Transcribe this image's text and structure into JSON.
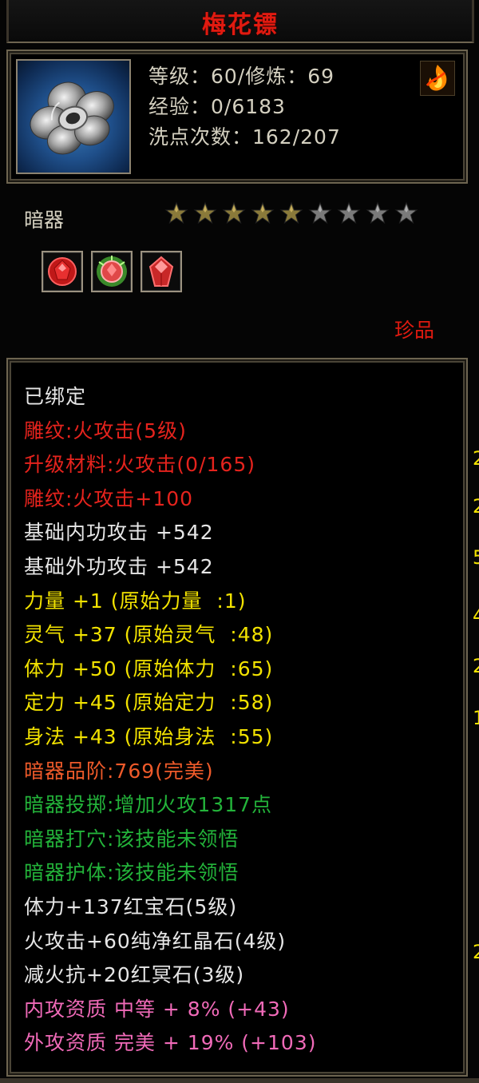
{
  "title": "梅花镖",
  "header": {
    "level_line": "等级：60/修炼：69",
    "exp_line": "经验：0/6183",
    "reset_line": "洗点次数：162/207",
    "icon": "plum-blossom-dart-icon",
    "badge_icon": "fire-element-icon"
  },
  "item_type": "暗器",
  "stars": {
    "filled": 5,
    "total": 9
  },
  "gems": [
    {
      "icon": "ruby-gem-icon",
      "color": "#e02020"
    },
    {
      "icon": "pure-red-crystal-icon",
      "color": "#d43a3a"
    },
    {
      "icon": "red-shard-icon",
      "color": "#e04040"
    }
  ],
  "rarity": "珍品",
  "attributes": [
    {
      "text": "已绑定",
      "color": "white"
    },
    {
      "text": "雕纹:火攻击(5级)",
      "color": "red"
    },
    {
      "text": "升级材料:火攻击(0/165)",
      "color": "red"
    },
    {
      "text": "雕纹:火攻击+100",
      "color": "red"
    },
    {
      "text": "基础内功攻击 +542",
      "color": "white"
    },
    {
      "text": "基础外功攻击 +542",
      "color": "white"
    },
    {
      "text": "力量 +1 (原始力量  :1)",
      "color": "yellow"
    },
    {
      "text": "灵气 +37 (原始灵气  :48)",
      "color": "yellow"
    },
    {
      "text": "体力 +50 (原始体力  :65)",
      "color": "yellow"
    },
    {
      "text": "定力 +45 (原始定力  :58)",
      "color": "yellow"
    },
    {
      "text": "身法 +43 (原始身法  :55)",
      "color": "yellow"
    },
    {
      "text": "暗器品阶:769(完美)",
      "color": "orange"
    },
    {
      "text": "暗器投掷:增加火攻1317点",
      "color": "green"
    },
    {
      "text": "暗器打穴:该技能未领悟",
      "color": "green"
    },
    {
      "text": "暗器护体:该技能未领悟",
      "color": "green"
    },
    {
      "text": "体力+137红宝石(5级)",
      "color": "white"
    },
    {
      "text": "火攻击+60纯净红晶石(4级)",
      "color": "white"
    },
    {
      "text": "减火抗+20红冥石(3级)",
      "color": "white"
    },
    {
      "text": "内攻资质 中等 + 8% (+43)",
      "color": "pink"
    },
    {
      "text": "外攻资质 完美 + 19% (+103)",
      "color": "pink"
    }
  ],
  "edge_digits": [
    "2",
    "2",
    "5",
    "4",
    "2",
    "1",
    "2"
  ]
}
